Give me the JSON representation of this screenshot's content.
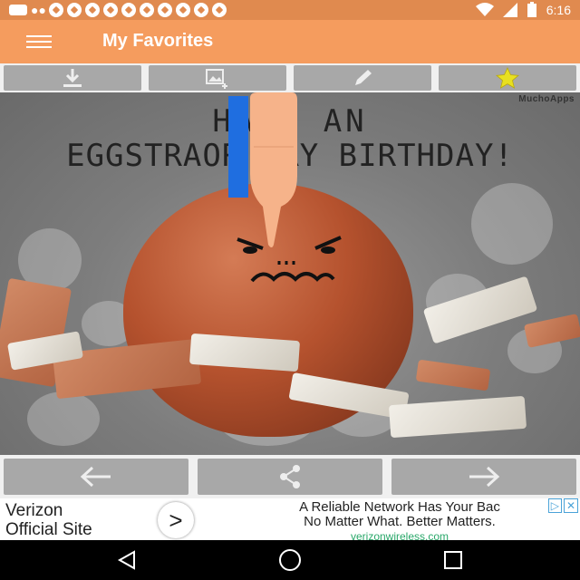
{
  "status_bar": {
    "time": "6:16"
  },
  "toolbar": {
    "title": "My Favorites"
  },
  "actions": {
    "download": "download-icon",
    "image_add": "image-add-icon",
    "edit": "pencil-icon",
    "favorite": "star-icon"
  },
  "image": {
    "watermark": "MuchoApps",
    "text_line1": "HA  E AN",
    "text_line2": "EGGSTRAOR   ARY BIRTHDAY!"
  },
  "bottom_nav": {
    "prev": "arrow-left-icon",
    "share": "share-icon",
    "next": "arrow-right-icon"
  },
  "ad": {
    "brand_line1": "Verizon",
    "brand_line2": "Official Site",
    "go_symbol": ">",
    "headline1": "A Reliable Network Has Your Bac",
    "headline2": "No Matter What. Better Matters.",
    "url": "verizonwireless.com"
  },
  "colors": {
    "status": "#e08a4f",
    "toolbar": "#f59c5e",
    "button": "#a8a8a8",
    "star": "#e8e020"
  }
}
